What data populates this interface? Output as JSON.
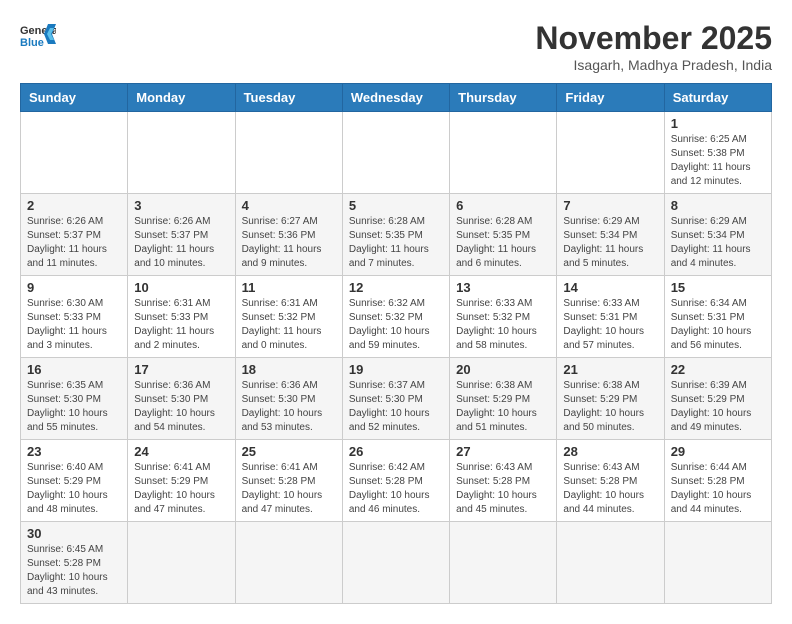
{
  "header": {
    "logo_general": "General",
    "logo_blue": "Blue",
    "month_title": "November 2025",
    "subtitle": "Isagarh, Madhya Pradesh, India"
  },
  "weekdays": [
    "Sunday",
    "Monday",
    "Tuesday",
    "Wednesday",
    "Thursday",
    "Friday",
    "Saturday"
  ],
  "weeks": [
    [
      {
        "day": "",
        "info": ""
      },
      {
        "day": "",
        "info": ""
      },
      {
        "day": "",
        "info": ""
      },
      {
        "day": "",
        "info": ""
      },
      {
        "day": "",
        "info": ""
      },
      {
        "day": "",
        "info": ""
      },
      {
        "day": "1",
        "info": "Sunrise: 6:25 AM\nSunset: 5:38 PM\nDaylight: 11 hours\nand 12 minutes."
      }
    ],
    [
      {
        "day": "2",
        "info": "Sunrise: 6:26 AM\nSunset: 5:37 PM\nDaylight: 11 hours\nand 11 minutes."
      },
      {
        "day": "3",
        "info": "Sunrise: 6:26 AM\nSunset: 5:37 PM\nDaylight: 11 hours\nand 10 minutes."
      },
      {
        "day": "4",
        "info": "Sunrise: 6:27 AM\nSunset: 5:36 PM\nDaylight: 11 hours\nand 9 minutes."
      },
      {
        "day": "5",
        "info": "Sunrise: 6:28 AM\nSunset: 5:35 PM\nDaylight: 11 hours\nand 7 minutes."
      },
      {
        "day": "6",
        "info": "Sunrise: 6:28 AM\nSunset: 5:35 PM\nDaylight: 11 hours\nand 6 minutes."
      },
      {
        "day": "7",
        "info": "Sunrise: 6:29 AM\nSunset: 5:34 PM\nDaylight: 11 hours\nand 5 minutes."
      },
      {
        "day": "8",
        "info": "Sunrise: 6:29 AM\nSunset: 5:34 PM\nDaylight: 11 hours\nand 4 minutes."
      }
    ],
    [
      {
        "day": "9",
        "info": "Sunrise: 6:30 AM\nSunset: 5:33 PM\nDaylight: 11 hours\nand 3 minutes."
      },
      {
        "day": "10",
        "info": "Sunrise: 6:31 AM\nSunset: 5:33 PM\nDaylight: 11 hours\nand 2 minutes."
      },
      {
        "day": "11",
        "info": "Sunrise: 6:31 AM\nSunset: 5:32 PM\nDaylight: 11 hours\nand 0 minutes."
      },
      {
        "day": "12",
        "info": "Sunrise: 6:32 AM\nSunset: 5:32 PM\nDaylight: 10 hours\nand 59 minutes."
      },
      {
        "day": "13",
        "info": "Sunrise: 6:33 AM\nSunset: 5:32 PM\nDaylight: 10 hours\nand 58 minutes."
      },
      {
        "day": "14",
        "info": "Sunrise: 6:33 AM\nSunset: 5:31 PM\nDaylight: 10 hours\nand 57 minutes."
      },
      {
        "day": "15",
        "info": "Sunrise: 6:34 AM\nSunset: 5:31 PM\nDaylight: 10 hours\nand 56 minutes."
      }
    ],
    [
      {
        "day": "16",
        "info": "Sunrise: 6:35 AM\nSunset: 5:30 PM\nDaylight: 10 hours\nand 55 minutes."
      },
      {
        "day": "17",
        "info": "Sunrise: 6:36 AM\nSunset: 5:30 PM\nDaylight: 10 hours\nand 54 minutes."
      },
      {
        "day": "18",
        "info": "Sunrise: 6:36 AM\nSunset: 5:30 PM\nDaylight: 10 hours\nand 53 minutes."
      },
      {
        "day": "19",
        "info": "Sunrise: 6:37 AM\nSunset: 5:30 PM\nDaylight: 10 hours\nand 52 minutes."
      },
      {
        "day": "20",
        "info": "Sunrise: 6:38 AM\nSunset: 5:29 PM\nDaylight: 10 hours\nand 51 minutes."
      },
      {
        "day": "21",
        "info": "Sunrise: 6:38 AM\nSunset: 5:29 PM\nDaylight: 10 hours\nand 50 minutes."
      },
      {
        "day": "22",
        "info": "Sunrise: 6:39 AM\nSunset: 5:29 PM\nDaylight: 10 hours\nand 49 minutes."
      }
    ],
    [
      {
        "day": "23",
        "info": "Sunrise: 6:40 AM\nSunset: 5:29 PM\nDaylight: 10 hours\nand 48 minutes."
      },
      {
        "day": "24",
        "info": "Sunrise: 6:41 AM\nSunset: 5:29 PM\nDaylight: 10 hours\nand 47 minutes."
      },
      {
        "day": "25",
        "info": "Sunrise: 6:41 AM\nSunset: 5:28 PM\nDaylight: 10 hours\nand 47 minutes."
      },
      {
        "day": "26",
        "info": "Sunrise: 6:42 AM\nSunset: 5:28 PM\nDaylight: 10 hours\nand 46 minutes."
      },
      {
        "day": "27",
        "info": "Sunrise: 6:43 AM\nSunset: 5:28 PM\nDaylight: 10 hours\nand 45 minutes."
      },
      {
        "day": "28",
        "info": "Sunrise: 6:43 AM\nSunset: 5:28 PM\nDaylight: 10 hours\nand 44 minutes."
      },
      {
        "day": "29",
        "info": "Sunrise: 6:44 AM\nSunset: 5:28 PM\nDaylight: 10 hours\nand 44 minutes."
      }
    ],
    [
      {
        "day": "30",
        "info": "Sunrise: 6:45 AM\nSunset: 5:28 PM\nDaylight: 10 hours\nand 43 minutes."
      },
      {
        "day": "",
        "info": ""
      },
      {
        "day": "",
        "info": ""
      },
      {
        "day": "",
        "info": ""
      },
      {
        "day": "",
        "info": ""
      },
      {
        "day": "",
        "info": ""
      },
      {
        "day": "",
        "info": ""
      }
    ]
  ]
}
